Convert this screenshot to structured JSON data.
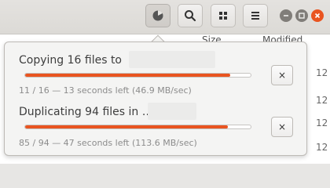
{
  "header": {
    "buttons": [
      {
        "name": "file-operations-icon"
      },
      {
        "name": "search-icon"
      },
      {
        "name": "grid-view-icon"
      },
      {
        "name": "menu-icon"
      }
    ],
    "window_controls": [
      "minimize-icon",
      "maximize-icon",
      "close-icon"
    ]
  },
  "list": {
    "col_size": "Size",
    "col_modified": "Modified",
    "row_time_fragment": "12"
  },
  "operations": [
    {
      "title": "Copying 16 files to",
      "progress": 0.91,
      "status": "11 / 16 — 13 seconds left (46.9 MB/sec)",
      "cancel_label": "×"
    },
    {
      "title": "Duplicating 94 files in …",
      "progress": 0.9,
      "status": "85 / 94 — 47 seconds left (113.6 MB/sec)",
      "cancel_label": "×"
    }
  ],
  "colors": {
    "accent": "#e95420",
    "close_button": "#e95420"
  }
}
